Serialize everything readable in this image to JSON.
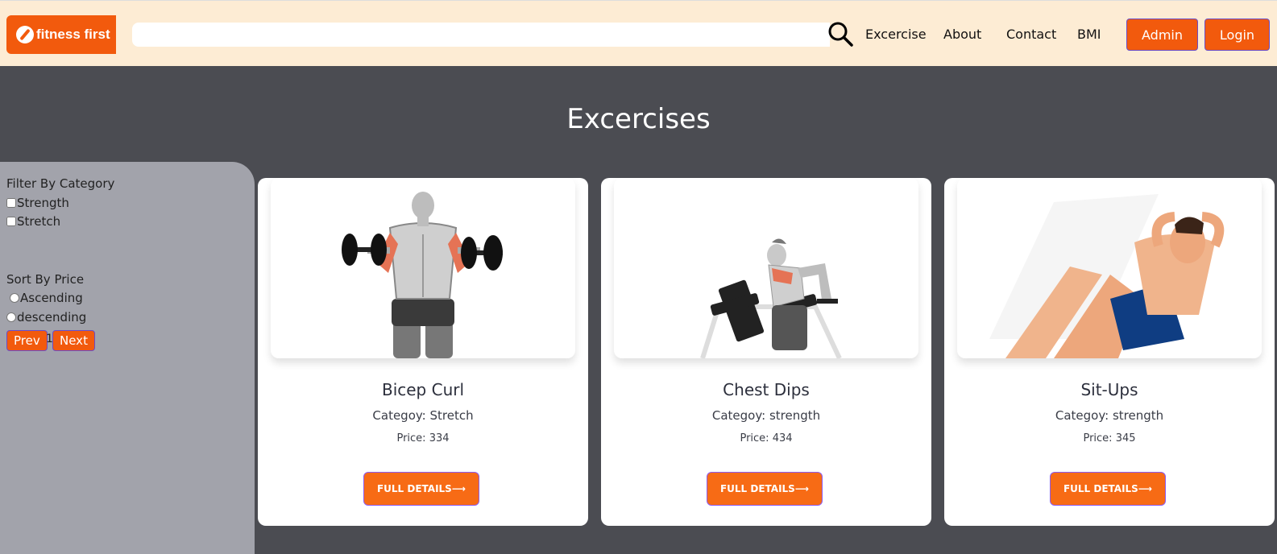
{
  "header": {
    "logo_text": "fitness first",
    "search": {
      "value": "",
      "placeholder": ""
    },
    "nav": [
      "Excercise",
      "About",
      "Contact",
      "BMI"
    ],
    "admin_label": "Admin",
    "login_label": "Login"
  },
  "page_title": "Excercises",
  "sidebar": {
    "filter_heading": "Filter By Category",
    "categories": [
      "Strength",
      "Stretch"
    ],
    "sort_heading": "Sort By Price",
    "sort_options": [
      "Ascending",
      "descending"
    ],
    "pager": {
      "prev": "Prev",
      "page": "1",
      "next": "Next"
    }
  },
  "cards": [
    {
      "title": "Bicep Curl",
      "category": "Categoy: Stretch",
      "price": "Price: 334",
      "button": "FULL DETAILS⟶"
    },
    {
      "title": "Chest Dips",
      "category": "Categoy: strength",
      "price": "Price: 434",
      "button": "FULL DETAILS⟶"
    },
    {
      "title": "Sit-Ups",
      "category": "Categoy: strength",
      "price": "Price: 345",
      "button": "FULL DETAILS⟶"
    }
  ],
  "colors": {
    "accent": "#f25a0d",
    "header_bg": "#fdecd4",
    "page_bg": "#4b4c52",
    "sidebar_bg": "#a2a3ab"
  }
}
